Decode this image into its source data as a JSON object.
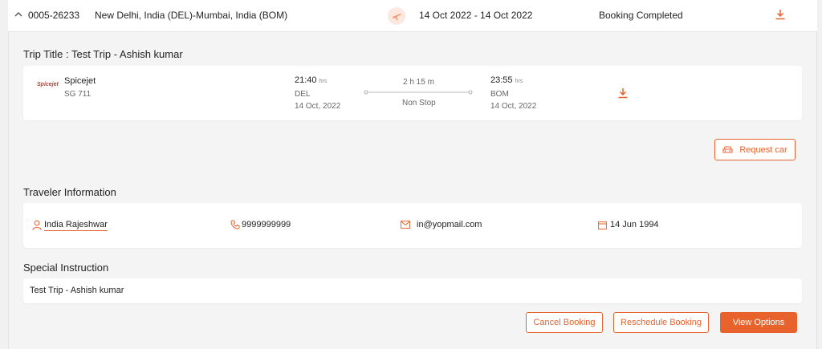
{
  "booking": {
    "id": "0005-26233",
    "route": "New Delhi, India (DEL)-Mumbai, India (BOM)",
    "dates": "14 Oct 2022 - 14 Oct 2022",
    "status": "Booking Completed"
  },
  "trip": {
    "title": "Trip Title : Test Trip - Ashish kumar"
  },
  "flight": {
    "airline_logo_text": "Spicejet",
    "airline": "Spicejet",
    "flight_no": "SG 711",
    "departure": {
      "time": "21:40",
      "unit": "hrs",
      "code": "DEL",
      "date": "14 Oct, 2022"
    },
    "duration": "2 h 15 m",
    "stops": "Non Stop",
    "arrival": {
      "time": "23:55",
      "unit": "hrs",
      "code": "BOM",
      "date": "14 Oct, 2022"
    }
  },
  "actions": {
    "request_car": "Request car",
    "cancel": "Cancel Booking",
    "reschedule": "Reschedule Booking",
    "view_options": "View Options"
  },
  "traveler": {
    "section_title": "Traveler Information",
    "name": "India Rajeshwar",
    "phone": "9999999999",
    "email": "in@yopmail.com",
    "dob": "14 Jun 1994"
  },
  "special": {
    "section_title": "Special Instruction",
    "text": "Test Trip - Ashish kumar"
  },
  "colors": {
    "accent": "#e8622c"
  },
  "icons": [
    "chevron-up-icon",
    "airplane-icon",
    "download-icon",
    "car-icon",
    "user-icon",
    "phone-icon",
    "mail-icon",
    "calendar-icon"
  ]
}
